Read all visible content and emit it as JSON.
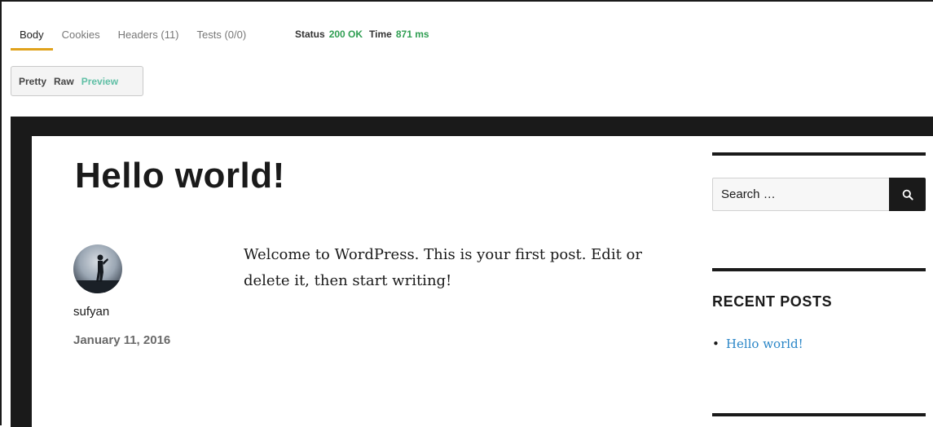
{
  "response_tabs": [
    {
      "label": "Body"
    },
    {
      "label": "Cookies"
    },
    {
      "label": "Headers (11)"
    },
    {
      "label": "Tests (0/0)"
    }
  ],
  "status": {
    "label": "Status",
    "value": "200 OK",
    "time_label": "Time",
    "time_value": "871 ms"
  },
  "view_modes": {
    "pretty": "Pretty",
    "raw": "Raw",
    "preview": "Preview"
  },
  "post": {
    "title": "Hello world!",
    "author": "sufyan",
    "date": "January 11, 2016",
    "content": "Welcome to WordPress. This is your first post. Edit or delete it, then start writing!"
  },
  "sidebar": {
    "search_placeholder": "Search …",
    "recent_posts_title": "RECENT POSTS",
    "recent_posts": [
      "Hello world!"
    ]
  },
  "colors": {
    "active_tab_underline": "#e0a21c",
    "status_green": "#2f9e52",
    "preview_mode": "#5fbfa5",
    "link": "#2a86c7"
  }
}
